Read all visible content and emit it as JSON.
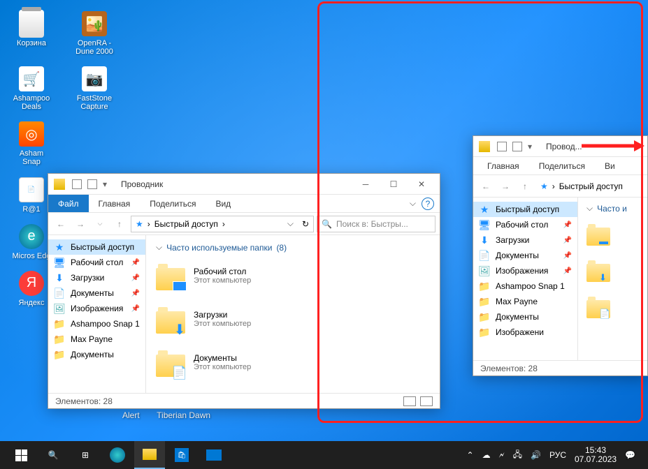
{
  "desktop": {
    "icons": [
      [
        {
          "name": "recycle-bin",
          "label": "Корзина"
        },
        {
          "name": "openra",
          "label": "OpenRA - Dune 2000"
        }
      ],
      [
        {
          "name": "ashampoo-deals",
          "label": "Ashampoo Deals"
        },
        {
          "name": "faststone",
          "label": "FastStone Capture"
        }
      ],
      [
        {
          "name": "ashampoo-snap",
          "label": "Asham Snap"
        }
      ],
      [
        {
          "name": "r-at-1",
          "label": "R@1"
        }
      ],
      [
        {
          "name": "edge",
          "label": "Micros Edg"
        }
      ],
      [
        {
          "name": "yandex",
          "label": "Яндекс"
        }
      ]
    ],
    "hidden_row": [
      {
        "label": "Alert"
      },
      {
        "label": "Tiberian Dawn"
      }
    ]
  },
  "explorer1": {
    "title": "Проводник",
    "tabs": {
      "file": "Файл",
      "home": "Главная",
      "share": "Поделиться",
      "view": "Вид"
    },
    "breadcrumb": "Быстрый доступ",
    "search_placeholder": "Поиск в: Быстры...",
    "section_header": "Часто используемые папки",
    "section_count": "(8)",
    "sidebar": [
      {
        "label": "Быстрый доступ",
        "icon": "star",
        "selected": true,
        "color": "#1e90ff"
      },
      {
        "label": "Рабочий стол",
        "icon": "desktop",
        "pinned": true,
        "color": "#1e90ff"
      },
      {
        "label": "Загрузки",
        "icon": "download",
        "pinned": true,
        "color": "#1e90ff"
      },
      {
        "label": "Документы",
        "icon": "document",
        "pinned": true,
        "color": "#555"
      },
      {
        "label": "Изображения",
        "icon": "image",
        "pinned": true,
        "color": "#4aa"
      },
      {
        "label": "Ashampoo Snap 1",
        "icon": "folder",
        "color": "#ffc83d"
      },
      {
        "label": "Max Payne",
        "icon": "folder",
        "color": "#ffc83d"
      },
      {
        "label": "Документы",
        "icon": "folder",
        "color": "#ffc83d"
      }
    ],
    "folders": [
      {
        "name": "Рабочий стол",
        "sub": "Этот компьютер",
        "overlay": "desktop"
      },
      {
        "name": "Загрузки",
        "sub": "Этот компьютер",
        "overlay": "download"
      },
      {
        "name": "Документы",
        "sub": "Этот компьютер",
        "overlay": "document"
      }
    ],
    "status": "Элементов: 28"
  },
  "explorer2": {
    "title": "Провод...",
    "tabs": {
      "home": "Главная",
      "share": "Поделиться",
      "view": "Ви"
    },
    "breadcrumb": "Быстрый доступ",
    "section_header": "Часто и",
    "sidebar": [
      {
        "label": "Быстрый доступ",
        "icon": "star",
        "selected": true,
        "color": "#1e90ff"
      },
      {
        "label": "Рабочий стол",
        "icon": "desktop",
        "pinned": true,
        "color": "#1e90ff"
      },
      {
        "label": "Загрузки",
        "icon": "download",
        "pinned": true,
        "color": "#1e90ff"
      },
      {
        "label": "Документы",
        "icon": "document",
        "pinned": true,
        "color": "#555"
      },
      {
        "label": "Изображения",
        "icon": "image",
        "pinned": true,
        "color": "#4aa"
      },
      {
        "label": "Ashampoo Snap 1",
        "icon": "folder",
        "color": "#ffc83d"
      },
      {
        "label": "Max Payne",
        "icon": "folder",
        "color": "#ffc83d"
      },
      {
        "label": "Документы",
        "icon": "folder",
        "color": "#ffc83d"
      },
      {
        "label": "Изображени",
        "icon": "folder",
        "color": "#ffc83d"
      }
    ],
    "status": "Элементов: 28"
  },
  "taskbar": {
    "tray": {
      "lang": "РУС",
      "time": "15:43",
      "date": "07.07.2023"
    }
  }
}
